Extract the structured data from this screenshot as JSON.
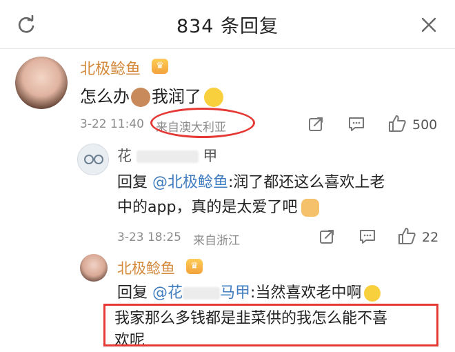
{
  "header": {
    "title": "834 条回复",
    "refresh_icon": "refresh-icon",
    "close_icon": "close-icon"
  },
  "comment": {
    "username": "北极鲶鱼",
    "text_part1": "怎么办",
    "text_part2": "我润了",
    "time": "3-22 11:40",
    "location": "来自澳大利亚",
    "likes": "500"
  },
  "replies": [
    {
      "username_visible": "花",
      "username_end": "甲",
      "prefix": "回复 ",
      "mention": "@北极鲶鱼",
      "line1": ":润了都还这么喜欢上老",
      "line2": "中的app，真的是太爱了吧",
      "time": "3-23 18:25",
      "location": "来自浙江",
      "likes": "22"
    },
    {
      "username": "北极鲶鱼",
      "prefix": "回复 ",
      "mention_start": "@花",
      "mention_end": "马甲",
      "after": ":当然喜欢老中啊",
      "line2": "我家那么多钱都是韭菜供的我怎么能不喜",
      "line3": "欢呢"
    }
  ],
  "colors": {
    "username": "#d4893b",
    "mention": "#3f7cc0",
    "highlight": "#e53935"
  }
}
